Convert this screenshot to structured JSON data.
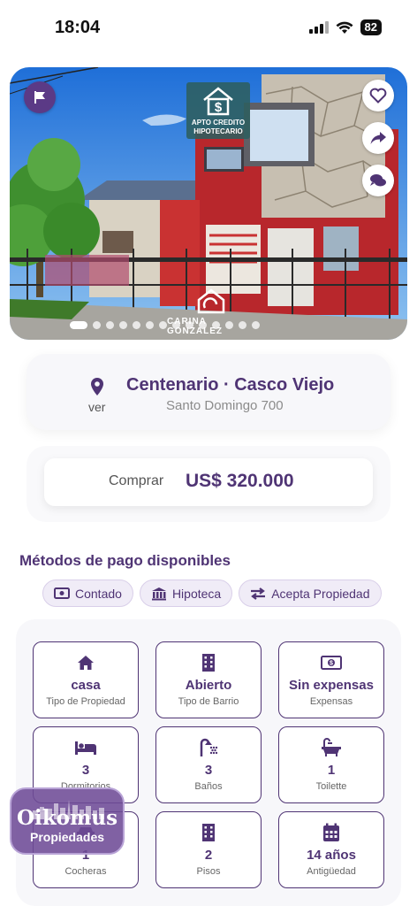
{
  "status_bar": {
    "time": "18:04",
    "battery": "82"
  },
  "hero": {
    "badge_line1": "APTO CREDITO",
    "badge_line2": "HIPOTECARIO",
    "brand_watermark": "CARINA GONZALEZ",
    "photo_count": 14,
    "active_photo": 1
  },
  "location": {
    "title": "Centenario · Casco Viejo",
    "address": "Santo Domingo 700",
    "map_link": "ver"
  },
  "price": {
    "operation": "Comprar",
    "value": "US$ 320.000"
  },
  "payment": {
    "title": "Métodos de pago disponibles",
    "methods": [
      {
        "label": "Contado",
        "icon": "cash-icon"
      },
      {
        "label": "Hipoteca",
        "icon": "bank-icon"
      },
      {
        "label": "Acepta Propiedad",
        "icon": "swap-icon"
      }
    ]
  },
  "features": [
    {
      "value": "casa",
      "label": "Tipo de Propiedad",
      "icon": "house-icon"
    },
    {
      "value": "Abierto",
      "label": "Tipo de Barrio",
      "icon": "building-icon"
    },
    {
      "value": "Sin expensas",
      "label": "Expensas",
      "icon": "money-icon"
    },
    {
      "value": "3",
      "label": "Dormitorios",
      "icon": "bed-icon"
    },
    {
      "value": "3",
      "label": "Baños",
      "icon": "shower-icon"
    },
    {
      "value": "1",
      "label": "Toilette",
      "icon": "bathtub-icon"
    },
    {
      "value": "1",
      "label": "Cocheras",
      "icon": "car-icon"
    },
    {
      "value": "2",
      "label": "Pisos",
      "icon": "building-icon"
    },
    {
      "value": "14 años",
      "label": "Antigüedad",
      "icon": "calendar-icon"
    }
  ],
  "floating_logo": {
    "name": "Oikomus",
    "subtitle": "Propiedades"
  },
  "colors": {
    "accent": "#4f3474",
    "chip_bg": "#f0ecf7",
    "card_bg": "#f7f7fa"
  }
}
